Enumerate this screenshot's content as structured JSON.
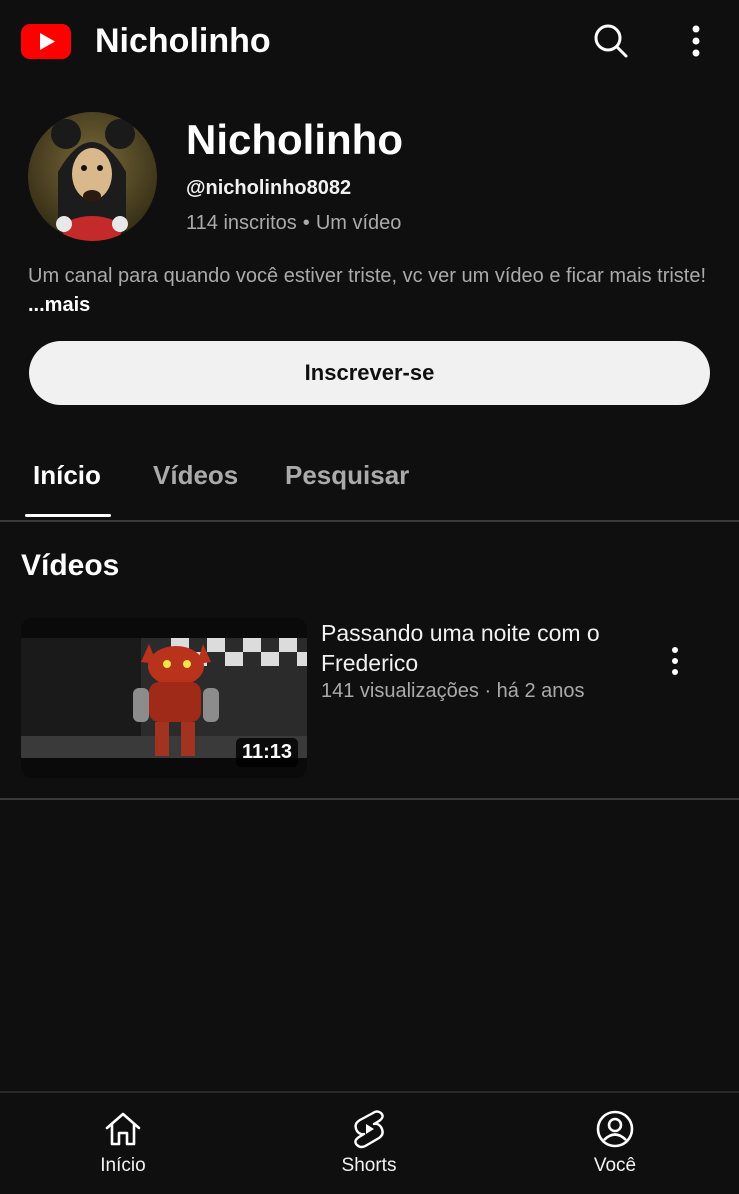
{
  "header": {
    "title": "Nicholinho",
    "logo_color": "#ff0000"
  },
  "channel": {
    "name": "Nicholinho",
    "handle": "@nicholinho8082",
    "subscribers": "114 inscritos",
    "separator": "•",
    "video_count": "Um vídeo",
    "description": "Um canal para quando você estiver triste, vc ver um vídeo e ficar mais triste!",
    "more_label": "...mais",
    "subscribe_label": "Inscrever-se"
  },
  "tabs": [
    {
      "label": "Início",
      "active": true
    },
    {
      "label": "Vídeos",
      "active": false
    },
    {
      "label": "Pesquisar",
      "active": false
    }
  ],
  "section": {
    "title": "Vídeos"
  },
  "videos": [
    {
      "title": "Passando uma noite com o Frederico",
      "views": "141 visualizações",
      "separator": "·",
      "age": "há 2 anos",
      "duration": "11:13"
    }
  ],
  "bottom_nav": [
    {
      "label": "Início",
      "icon": "home-icon"
    },
    {
      "label": "Shorts",
      "icon": "shorts-icon"
    },
    {
      "label": "Você",
      "icon": "account-icon"
    }
  ],
  "colors": {
    "background": "#0f0f0f",
    "text_primary": "#f1f1f1",
    "text_secondary": "#aaaaaa",
    "subscribe_bg": "#f1f1f1"
  }
}
